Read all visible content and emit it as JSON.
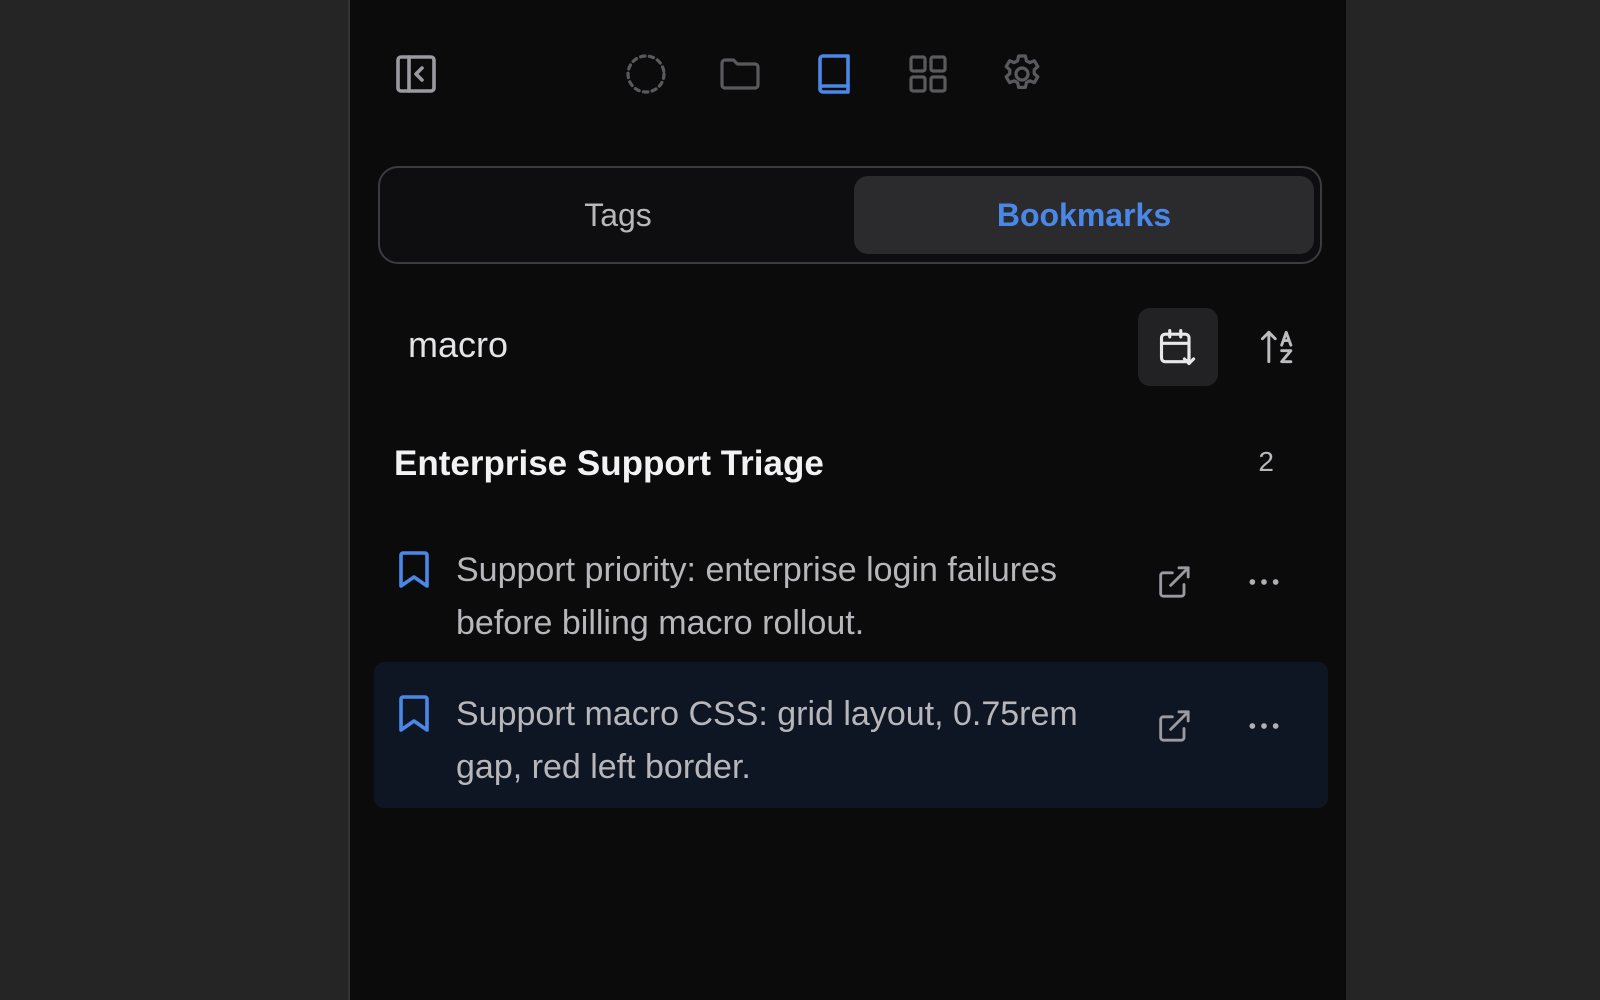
{
  "toolbar": {
    "icons": [
      "sidebar-toggle-icon",
      "dashed-circle-icon",
      "folder-icon",
      "book-icon",
      "grid-icon",
      "gear-icon"
    ],
    "active": "book-icon"
  },
  "tabs": {
    "tags_label": "Tags",
    "bookmarks_label": "Bookmarks",
    "active": "Bookmarks"
  },
  "filter": {
    "query": "macro"
  },
  "group": {
    "title": "Enterprise Support Triage",
    "count": "2"
  },
  "bookmarks": [
    {
      "text": "Support priority: enterprise login failures before billing macro rollout."
    },
    {
      "text": "Support macro CSS: grid layout, 0.75rem gap, red left border."
    }
  ],
  "colors": {
    "accent": "#4a88e8",
    "panel_bg": "#0b0b0c",
    "outer_bg": "#252525",
    "hover_row": "#0f1623",
    "muted_icon": "#5a5a5e"
  }
}
